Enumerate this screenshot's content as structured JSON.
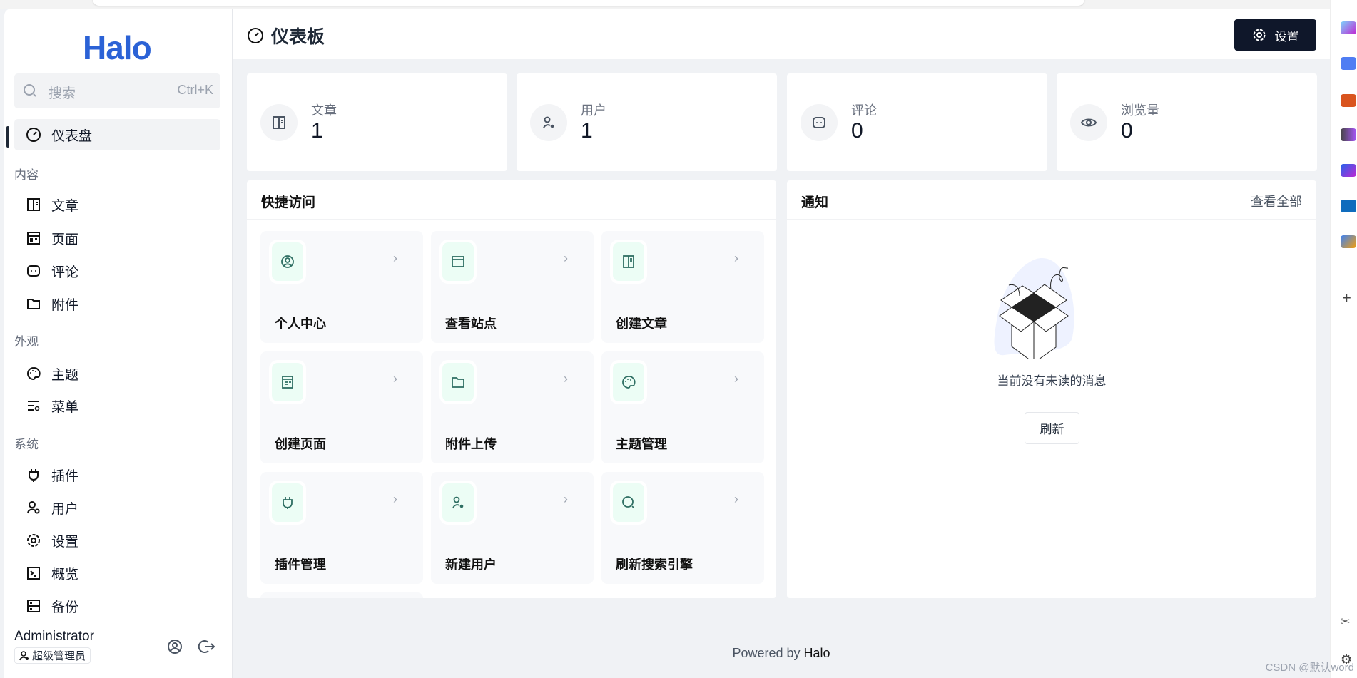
{
  "sidebar": {
    "logo": "Halo",
    "search": {
      "placeholder": "搜索",
      "shortcut": "Ctrl+K"
    },
    "dashboard": "仪表盘",
    "sections": [
      {
        "title": "内容",
        "items": [
          "文章",
          "页面",
          "评论",
          "附件"
        ]
      },
      {
        "title": "外观",
        "items": [
          "主题",
          "菜单"
        ]
      },
      {
        "title": "系统",
        "items": [
          "插件",
          "用户",
          "设置",
          "概览",
          "备份"
        ]
      }
    ],
    "user": {
      "name": "Administrator",
      "role": "超级管理员"
    }
  },
  "header": {
    "title": "仪表板",
    "settings_label": "设置"
  },
  "stats": [
    {
      "label": "文章",
      "value": "1"
    },
    {
      "label": "用户",
      "value": "1"
    },
    {
      "label": "评论",
      "value": "0"
    },
    {
      "label": "浏览量",
      "value": "0"
    }
  ],
  "quick_access": {
    "title": "快捷访问",
    "items": [
      "个人中心",
      "查看站点",
      "创建文章",
      "创建页面",
      "附件上传",
      "主题管理",
      "插件管理",
      "新建用户",
      "刷新搜索引擎"
    ]
  },
  "notifications": {
    "title": "通知",
    "view_all": "查看全部",
    "empty": "当前没有未读的消息",
    "refresh": "刷新"
  },
  "footer": {
    "prefix": "Powered by ",
    "brand": "Halo"
  },
  "watermark": "CSDN @默认word",
  "colors": {
    "accent": "#0f172a",
    "brand": "#2b62d6",
    "tile_icon": "#2f6f63"
  }
}
